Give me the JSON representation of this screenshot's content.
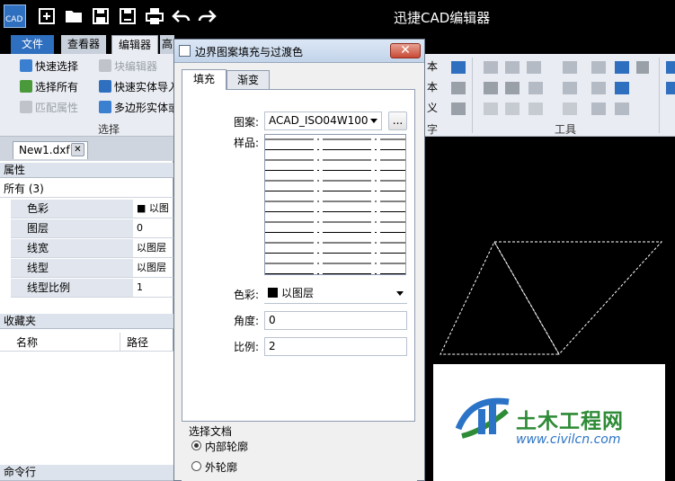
{
  "app": {
    "title": "迅捷CAD编辑器",
    "logo_text": "CAD"
  },
  "tabs": [
    {
      "label": "文件",
      "active": false,
      "accent": true
    },
    {
      "label": "查看器",
      "active": false
    },
    {
      "label": "编辑器",
      "active": true
    },
    {
      "label": "高",
      "active": false
    }
  ],
  "ribbon": {
    "select_group": {
      "quick_select": "快速选择",
      "select_all": "选择所有",
      "match_props": "匹配属性",
      "label": "选择"
    },
    "block_group": {
      "block_editor": "块编辑器",
      "quick_import": "快速实体导入",
      "polygon": "多边形实体或"
    },
    "text_fragments": [
      "本",
      "本",
      "义",
      "字"
    ],
    "tools_label": "工具"
  },
  "doc_tab": {
    "name": "New1.dxf",
    "close": "✕"
  },
  "properties": {
    "header": "属性",
    "filter": "所有 (3)",
    "rows": [
      {
        "key": "色彩",
        "value": "■ 以图"
      },
      {
        "key": "图层",
        "value": "0"
      },
      {
        "key": "线宽",
        "value": "以图层"
      },
      {
        "key": "线型",
        "value": "以图层"
      },
      {
        "key": "线型比例",
        "value": "1"
      }
    ]
  },
  "favorites": {
    "header": "收藏夹",
    "col_name": "名称",
    "col_path": "路径"
  },
  "command_line": {
    "header": "命令行"
  },
  "dialog": {
    "title": "边界图案填充与过渡色",
    "close_glyph": "✕",
    "tabs": [
      "填充",
      "渐变"
    ],
    "pattern_label": "图案:",
    "pattern_value": "ACAD_ISO04W100",
    "browse_label": "...",
    "sample_label": "样品:",
    "color_label": "色彩:",
    "color_value": "以图层",
    "angle_label": "角度:",
    "angle_value": "0",
    "scale_label": "比例:",
    "scale_value": "2",
    "boundary": {
      "label": "选择文档",
      "option_inner": "内部轮廓",
      "option_outer": "外轮廓",
      "selected": "内部轮廓"
    }
  },
  "watermark": {
    "brand": "土木工程网",
    "url": "www.civilcn.com"
  },
  "colors": {
    "accent_tab": "#2f6fbf",
    "ribbon_bg": "#e9ecf2",
    "brand_green": "#2e8b36",
    "brand_blue": "#2b73c6"
  }
}
